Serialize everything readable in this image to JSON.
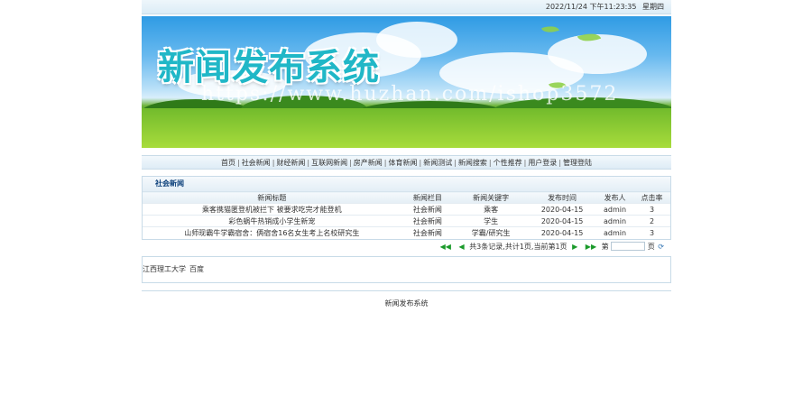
{
  "topbar": {
    "datetime": "2022/11/24 下午11:23:35",
    "weekday": "星期四"
  },
  "banner": {
    "title": "新闻发布系统",
    "watermark": "https://www.huzhan.com/ishop3572"
  },
  "nav": {
    "items": [
      "首页",
      "社会新闻",
      "财经新闻",
      "互联网新闻",
      "房产新闻",
      "体育新闻",
      "新闻测试",
      "新闻搜索",
      "个性推荐",
      "用户登录",
      "管理登陆"
    ]
  },
  "panel": {
    "title": "社会新闻",
    "columns": [
      "新闻标题",
      "新闻栏目",
      "新闻关键字",
      "发布时间",
      "发布人",
      "点击率"
    ],
    "rows": [
      {
        "title": "乘客携猫匿登机被拦下 被要求吃完才能登机",
        "category": "社会新闻",
        "keyword": "乘客",
        "date": "2020-04-15",
        "author": "admin",
        "clicks": "3"
      },
      {
        "title": "彩色蜗牛热销成小学生新宠",
        "category": "社会新闻",
        "keyword": "学生",
        "date": "2020-04-15",
        "author": "admin",
        "clicks": "2"
      },
      {
        "title": "山师现霸牛学霸宿舍：俩宿舍16名女生考上名校研究生",
        "category": "社会新闻",
        "keyword": "学霸/研究生",
        "date": "2020-04-15",
        "author": "admin",
        "clicks": "3"
      }
    ]
  },
  "pager": {
    "summary": "共3条记录,共计1页,当前第1页",
    "goto_prefix": "第",
    "goto_suffix": "页",
    "first_icon": "first-page-icon",
    "prev_icon": "prev-page-icon",
    "next_icon": "next-page-icon",
    "last_icon": "last-page-icon",
    "go_icon": "go-icon"
  },
  "links": {
    "items": [
      "江西理工大学",
      "百度"
    ]
  },
  "footer": {
    "text": "新闻发布系统"
  }
}
